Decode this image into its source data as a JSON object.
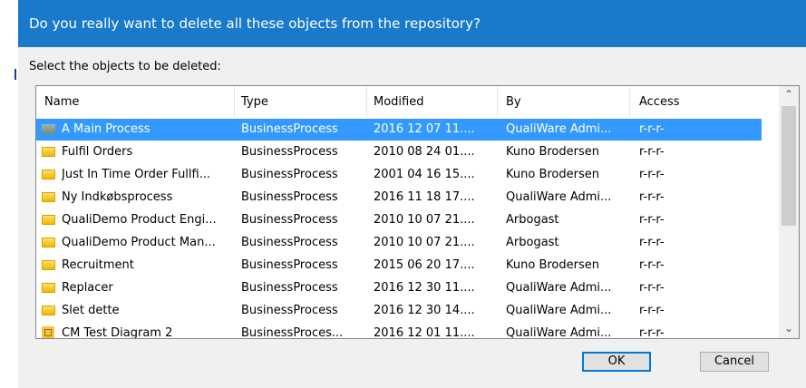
{
  "dialog": {
    "title": "Do you really want to delete all these objects from the repository?",
    "prompt": "Select the objects to be deleted:",
    "ok_label": "OK",
    "cancel_label": "Cancel"
  },
  "columns": [
    "Name",
    "Type",
    "Modified",
    "By",
    "Access"
  ],
  "rows": [
    {
      "name": "A Main Process",
      "type": "BusinessProcess",
      "modified": "2016 12 07 11....",
      "by": "QualiWare Admi...",
      "access": "r-r-r-",
      "icon": "gray-process-icon",
      "selected": true
    },
    {
      "name": "Fulfil Orders",
      "type": "BusinessProcess",
      "modified": "2010 08 24 01....",
      "by": "Kuno Brodersen",
      "access": "r-r-r-",
      "icon": "yellow-process-icon"
    },
    {
      "name": "Just In Time Order Fullfi...",
      "type": "BusinessProcess",
      "modified": "2001 04 16 15....",
      "by": "Kuno Brodersen",
      "access": "r-r-r-",
      "icon": "yellow-process-icon"
    },
    {
      "name": "Ny Indkøbsprocess",
      "type": "BusinessProcess",
      "modified": "2016 11 18 17....",
      "by": "QualiWare Admi...",
      "access": "r-r-r-",
      "icon": "yellow-process-icon"
    },
    {
      "name": "QualiDemo Product Engi...",
      "type": "BusinessProcess",
      "modified": "2010 10 07 21....",
      "by": "Arbogast",
      "access": "r-r-r-",
      "icon": "yellow-process-icon"
    },
    {
      "name": "QualiDemo Product Man...",
      "type": "BusinessProcess",
      "modified": "2010 10 07 21....",
      "by": "Arbogast",
      "access": "r-r-r-",
      "icon": "yellow-process-icon"
    },
    {
      "name": "Recruitment",
      "type": "BusinessProcess",
      "modified": "2015 06 20 17....",
      "by": "Kuno Brodersen",
      "access": "r-r-r-",
      "icon": "yellow-process-icon"
    },
    {
      "name": "Replacer",
      "type": "BusinessProcess",
      "modified": "2016 12 30 11....",
      "by": "QualiWare Admi...",
      "access": "r-r-r-",
      "icon": "yellow-process-icon"
    },
    {
      "name": "Slet dette",
      "type": "BusinessProcess",
      "modified": "2016 12 30 14....",
      "by": "QualiWare Admi...",
      "access": "r-r-r-",
      "icon": "yellow-process-icon"
    },
    {
      "name": "CM Test Diagram 2",
      "type": "BusinessProces...",
      "modified": "2016 12 01 11....",
      "by": "QualiWare Admi...",
      "access": "r-r-r-",
      "icon": "diagram-icon"
    }
  ],
  "colors": {
    "title_bar": "#1979ca",
    "selection": "#3399ff",
    "dialog_bg": "#f0f0f0"
  }
}
